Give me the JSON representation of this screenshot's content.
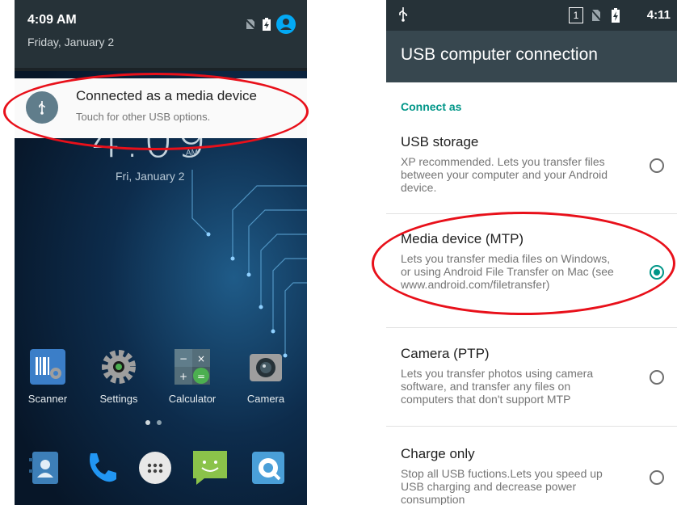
{
  "left_phone": {
    "shade": {
      "time": "4:09 AM",
      "date": "Friday, January 2"
    },
    "notification": {
      "title": "Connected as a media device",
      "subtitle": "Touch for other USB options."
    },
    "lockscreen": {
      "clock": "4:09",
      "ampm": "AM",
      "date": "Fri, January 2"
    },
    "apps": [
      {
        "label": "Scanner",
        "icon": "scanner-icon"
      },
      {
        "label": "Settings",
        "icon": "settings-gear-icon"
      },
      {
        "label": "Calculator",
        "icon": "calculator-icon"
      },
      {
        "label": "Camera",
        "icon": "camera-icon"
      }
    ],
    "dock": [
      "contacts-icon",
      "phone-icon",
      "app-drawer-icon",
      "messaging-icon",
      "browser-icon"
    ]
  },
  "right_phone": {
    "status": {
      "sim_slot": "1",
      "time": "4:11"
    },
    "toolbar_title": "USB computer connection",
    "section_header": "Connect as",
    "options": [
      {
        "title": "USB storage",
        "desc": "XP recommended. Lets you transfer files between your computer and your Android device.",
        "selected": false
      },
      {
        "title": "Media device (MTP)",
        "desc": "Lets you transfer media files on Windows, or using Android File Transfer on Mac (see www.android.com/filetransfer)",
        "selected": true
      },
      {
        "title": "Camera (PTP)",
        "desc": "Lets you transfer photos using camera software, and transfer any files on computers that don't support MTP",
        "selected": false
      },
      {
        "title": "Charge only",
        "desc": "Stop all USB fuctions.Lets you speed up USB charging and decrease power consumption",
        "selected": false
      }
    ]
  },
  "colors": {
    "accent": "#009688",
    "toolbar": "#37474f",
    "highlight": "#e8101a"
  }
}
